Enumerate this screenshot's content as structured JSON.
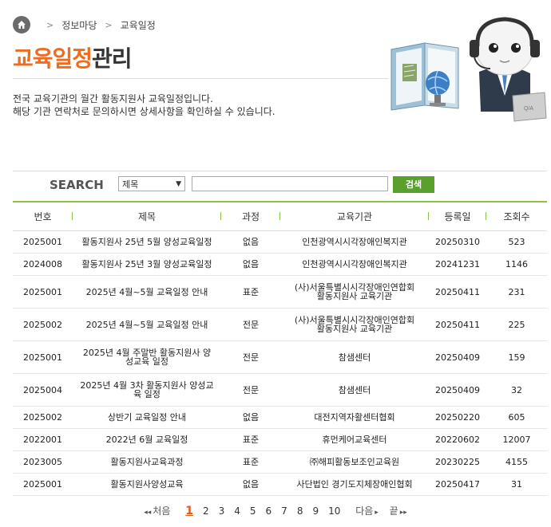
{
  "breadcrumb": {
    "items": [
      "정보마당",
      "교육일정"
    ]
  },
  "title": {
    "accent": "교육일정",
    "rest": "관리"
  },
  "description": {
    "line1": "전국 교육기관의 월간 활동지원사 교육일정입니다.",
    "line2": "해당 기관 연락처로 문의하시면 상세사항을 확인하실 수 있습니다."
  },
  "illustration": {
    "qa_text": "Q/A"
  },
  "search": {
    "label": "SEARCH",
    "select_value": "제목",
    "button": "검색"
  },
  "table": {
    "headers": [
      "번호",
      "제목",
      "과정",
      "교육기관",
      "등록일",
      "조회수"
    ],
    "rows": [
      {
        "no": "2025001",
        "title1": "활동지원사 25년 5월 양성교육일정",
        "title2": "",
        "course": "없음",
        "org1": "인천광역시시각장애인복지관",
        "org2": "",
        "date": "20250310",
        "views": "523"
      },
      {
        "no": "2024008",
        "title1": "활동지원사 25년 3월 양성교육일정",
        "title2": "",
        "course": "없음",
        "org1": "인천광역시시각장애인복지관",
        "org2": "",
        "date": "20241231",
        "views": "1146"
      },
      {
        "no": "2025001",
        "title1": "2025년 4월~5월 교육일정 안내",
        "title2": "",
        "course": "표준",
        "org1": "(사)서울특별시시각장애인연합회",
        "org2": "활동지원사 교육기관",
        "date": "20250411",
        "views": "231"
      },
      {
        "no": "2025002",
        "title1": "2025년 4월~5월 교육일정 안내",
        "title2": "",
        "course": "전문",
        "org1": "(사)서울특별시시각장애인연합회",
        "org2": "활동지원사 교육기관",
        "date": "20250411",
        "views": "225"
      },
      {
        "no": "2025001",
        "title1": "2025년 4월 주말반 활동지원사 양",
        "title2": "성교육 일정",
        "course": "전문",
        "org1": "참샘센터",
        "org2": "",
        "date": "20250409",
        "views": "159"
      },
      {
        "no": "2025004",
        "title1": "2025년 4월 3차 활동지원사 양성교",
        "title2": "육 일정",
        "course": "전문",
        "org1": "참샘센터",
        "org2": "",
        "date": "20250409",
        "views": "32"
      },
      {
        "no": "2025002",
        "title1": "상반기 교육일정 안내",
        "title2": "",
        "course": "없음",
        "org1": "대전지역자활센터협회",
        "org2": "",
        "date": "20250220",
        "views": "605"
      },
      {
        "no": "2022001",
        "title1": "2022년 6월 교육일정",
        "title2": "",
        "course": "표준",
        "org1": "휴먼케어교육센터",
        "org2": "",
        "date": "20220602",
        "views": "12007"
      },
      {
        "no": "2023005",
        "title1": "활동지원사교육과정",
        "title2": "",
        "course": "표준",
        "org1": "㈜해피활동보조인교육원",
        "org2": "",
        "date": "20230225",
        "views": "4155"
      },
      {
        "no": "2025001",
        "title1": "활동지원사양성교육",
        "title2": "",
        "course": "없음",
        "org1": "사단법인 경기도지체장애인협회",
        "org2": "",
        "date": "20250417",
        "views": "31"
      }
    ]
  },
  "pager": {
    "first": "처음",
    "pages": [
      "1",
      "2",
      "3",
      "4",
      "5",
      "6",
      "7",
      "8",
      "9",
      "10"
    ],
    "current": "1",
    "next": "다음",
    "last": "끝"
  }
}
